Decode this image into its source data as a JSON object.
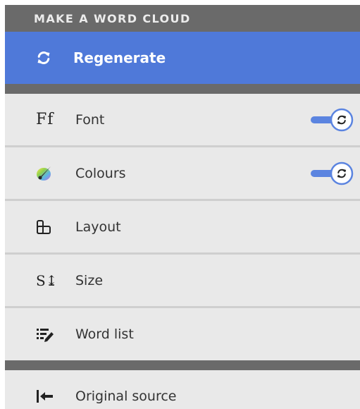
{
  "header": {
    "title": "MAKE A WORD CLOUD"
  },
  "regenerate": {
    "label": "Regenerate"
  },
  "items": [
    {
      "label": "Font",
      "icon": "font-icon",
      "glyph": "Ff",
      "toggle": true
    },
    {
      "label": "Colours",
      "icon": "palette-icon",
      "toggle": true
    },
    {
      "label": "Layout",
      "icon": "layout-icon"
    },
    {
      "label": "Size",
      "icon": "size-icon",
      "glyph": "S↨"
    },
    {
      "label": "Word list",
      "icon": "word-list-icon"
    }
  ],
  "footer": {
    "label": "Original source",
    "icon": "return-arrow-icon"
  },
  "colors": {
    "accent": "#4f79d9",
    "header_bg": "#6a6a6a",
    "panel_bg": "#e9e9e9",
    "toggle_blue": "#5b84e0"
  }
}
